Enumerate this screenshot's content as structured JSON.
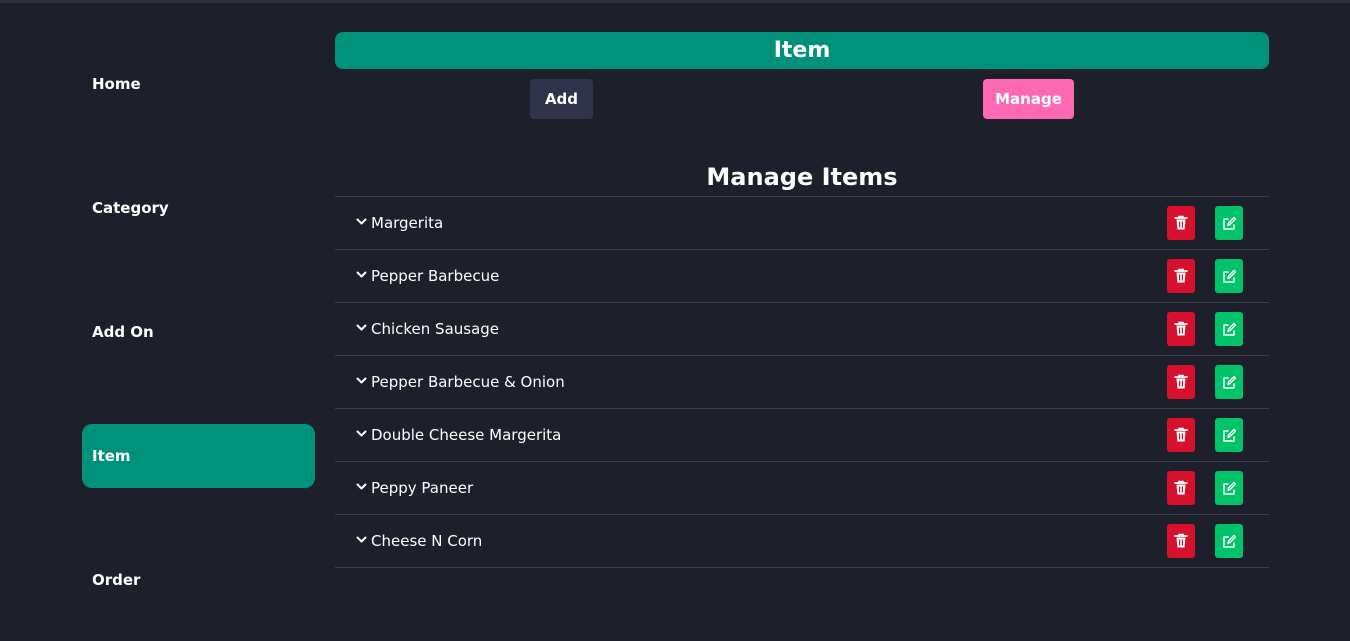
{
  "sidebar": {
    "items": [
      {
        "label": "Home",
        "active": false
      },
      {
        "label": "Category",
        "active": false
      },
      {
        "label": "Add On",
        "active": false
      },
      {
        "label": "Item",
        "active": true
      },
      {
        "label": "Order",
        "active": false
      }
    ]
  },
  "header": {
    "title": "Item"
  },
  "actions": {
    "add_label": "Add",
    "manage_label": "Manage"
  },
  "section": {
    "title": "Manage Items"
  },
  "items": [
    {
      "name": "Margerita"
    },
    {
      "name": "Pepper Barbecue"
    },
    {
      "name": "Chicken Sausage"
    },
    {
      "name": "Pepper Barbecue & Onion"
    },
    {
      "name": "Double Cheese Margerita"
    },
    {
      "name": "Peppy Paneer"
    },
    {
      "name": "Cheese N Corn"
    }
  ],
  "icons": {
    "row_toggle": "chevron-down-icon",
    "delete": "trash-icon",
    "edit": "edit-icon"
  },
  "colors": {
    "background": "#1d202b",
    "accent": "#00917b",
    "add_button": "#2f344a",
    "manage_button": "#ff69b4",
    "delete_button": "#d7102e",
    "edit_button": "#00c46a"
  }
}
